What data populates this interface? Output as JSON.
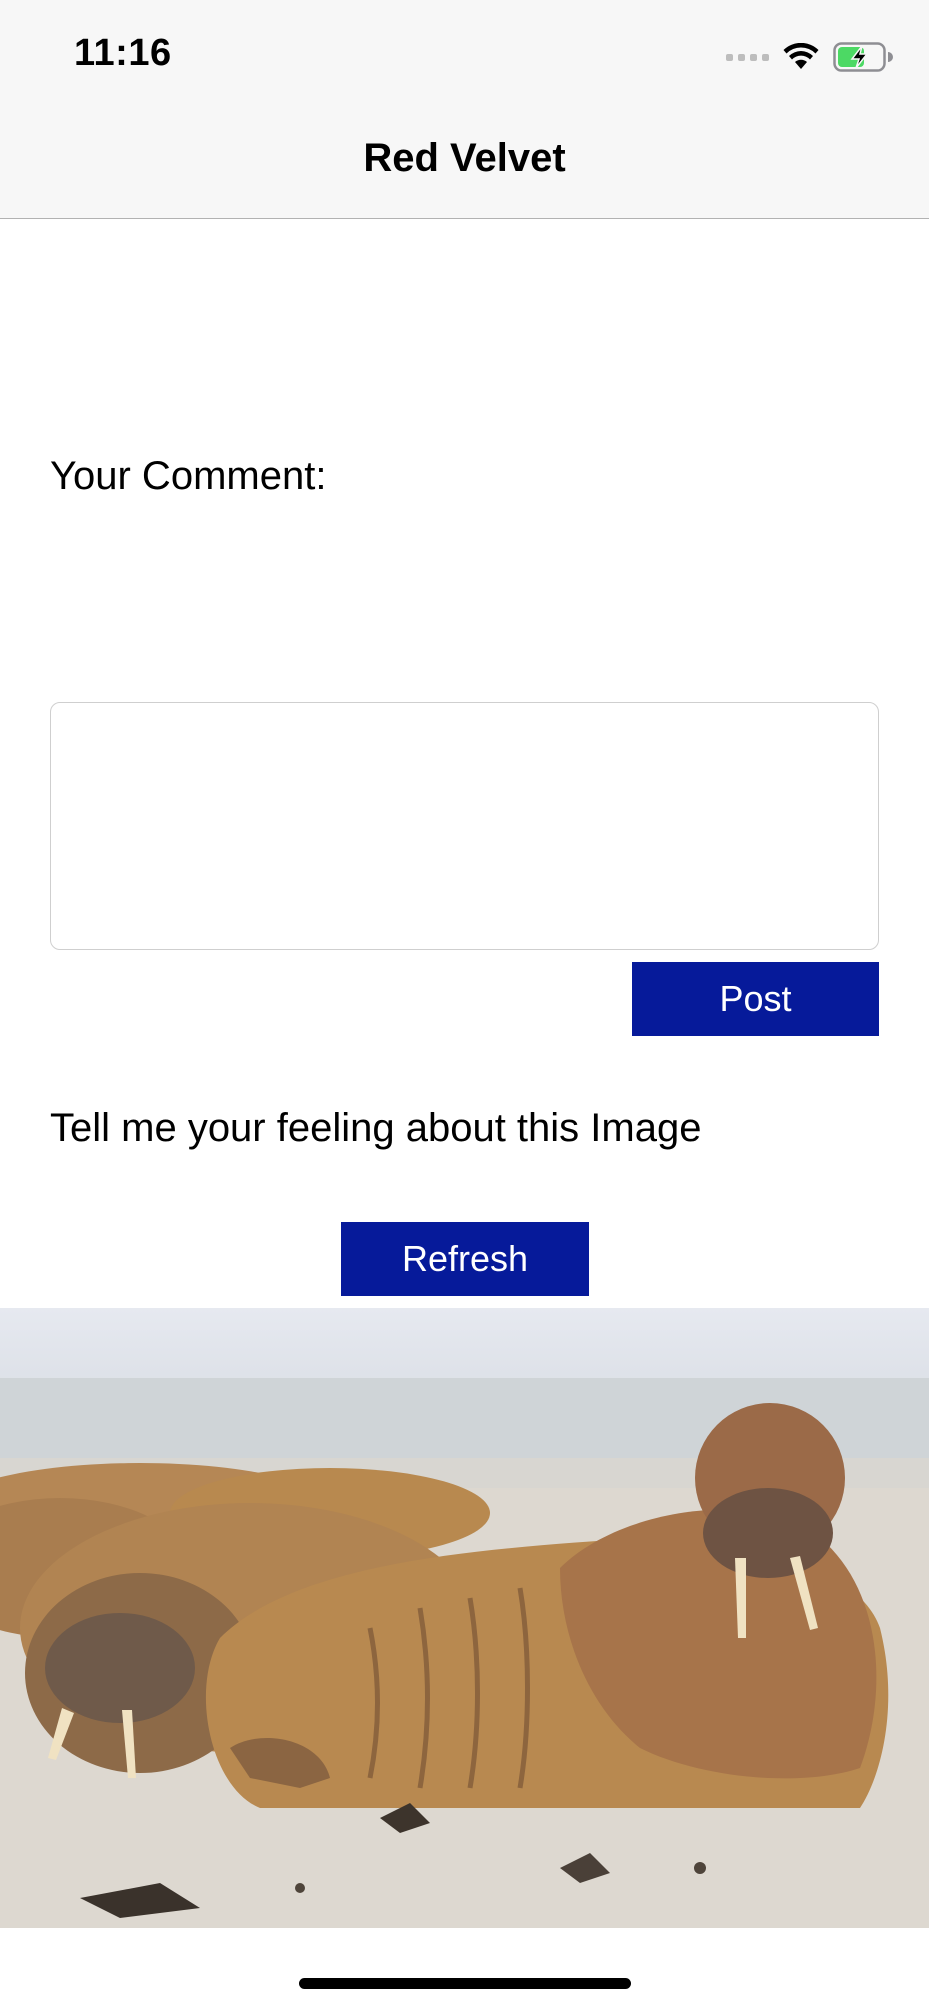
{
  "status_bar": {
    "time": "11:16"
  },
  "nav": {
    "title": "Red Velvet"
  },
  "form": {
    "comment_label": "Your Comment:",
    "comment_value": "",
    "post_label": "Post",
    "feeling_label": "Tell me your feeling about this Image",
    "refresh_label": "Refresh"
  },
  "photo": {
    "subject": "walruses resting on a sandy beach"
  },
  "colors": {
    "button_bg": "#061a9a",
    "nav_bg": "#f7f7f7",
    "battery_green": "#4cd964"
  },
  "icons": [
    "cellular-signal-icon",
    "wifi-icon",
    "battery-charging-icon"
  ]
}
